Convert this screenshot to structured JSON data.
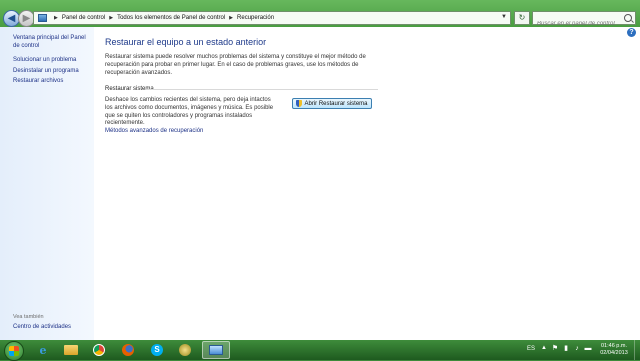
{
  "address_bar": {
    "breadcrumbs": [
      "Panel de control",
      "Todos los elementos de Panel de control",
      "Recuperación"
    ],
    "search_placeholder": "Buscar en el panel de control"
  },
  "left_pane": {
    "links": [
      "Ventana principal del Panel de control",
      "Solucionar un problema",
      "Desinstalar un programa",
      "Restaurar archivos"
    ],
    "see_also_label": "Vea también",
    "see_also_links": [
      "Centro de actividades"
    ]
  },
  "main": {
    "title": "Restaurar el equipo a un estado anterior",
    "description": "Restaurar sistema puede resolver muchos problemas del sistema y constituye el mejor método de recuperación para probar en primer lugar. En el caso de problemas graves, use los métodos de recuperación avanzados.",
    "section_title": "Restaurar sistema",
    "section_description": "Deshace los cambios recientes del sistema, pero deja intactos los archivos como documentos, imágenes y música. Es posible que se quiten los controladores y programas instalados recientemente.",
    "open_button": "Abrir Restaurar sistema",
    "advanced_link": "Métodos avanzados de recuperación"
  },
  "taskbar": {
    "pinned_icons": [
      "internet-explorer-icon",
      "file-explorer-icon",
      "chrome-icon",
      "firefox-icon",
      "skype-icon",
      "app-icon",
      "control-panel-icon"
    ],
    "language": "ES",
    "time": "01:46 p.m.",
    "date": "02/04/2013"
  },
  "colors": {
    "window_frame": "#4f9e46",
    "link": "#1e3287",
    "heading": "#1e3a8a",
    "taskbar": "#2d6f2c"
  }
}
